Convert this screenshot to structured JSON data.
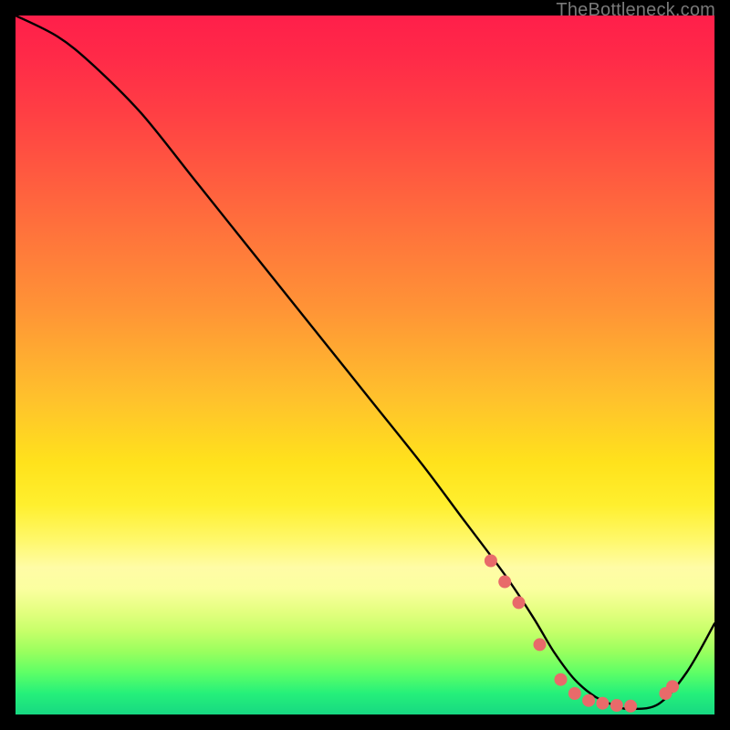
{
  "watermark": "TheBottleneck.com",
  "chart_data": {
    "type": "line",
    "title": "",
    "xlabel": "",
    "ylabel": "",
    "xlim": [
      0,
      100
    ],
    "ylim": [
      0,
      100
    ],
    "grid": false,
    "legend": false,
    "series": [
      {
        "name": "curve",
        "x": [
          0,
          6,
          11,
          18,
          26,
          34,
          42,
          50,
          58,
          64,
          70,
          74,
          77,
          80,
          83,
          86,
          88,
          92,
          96,
          100
        ],
        "y": [
          100,
          97,
          93,
          86,
          76,
          66,
          56,
          46,
          36,
          28,
          20,
          14,
          9,
          5,
          2.5,
          1.2,
          0.8,
          1.5,
          6,
          13
        ],
        "note": "y is approximate bottleneck percentage; curve shows steep decrease, near-zero trough around x≈80–90, then rises"
      }
    ],
    "markers": {
      "note": "salmon dots along the near-bottom portion of the curve",
      "x": [
        68,
        70,
        72,
        75,
        78,
        80,
        82,
        84,
        86,
        88,
        93,
        94
      ],
      "y": [
        22,
        19,
        16,
        10,
        5,
        3,
        2,
        1.6,
        1.3,
        1.2,
        3,
        4
      ]
    },
    "background_gradient": {
      "orientation": "vertical",
      "stops": [
        {
          "pos": 0.0,
          "color": "#ff1f4a"
        },
        {
          "pos": 0.28,
          "color": "#ff6a3d"
        },
        {
          "pos": 0.55,
          "color": "#ffc22c"
        },
        {
          "pos": 0.75,
          "color": "#fff86a"
        },
        {
          "pos": 0.9,
          "color": "#9aff5e"
        },
        {
          "pos": 1.0,
          "color": "#17d882"
        }
      ]
    },
    "colors": {
      "curve": "#000000",
      "markers": "#e86a6a",
      "frame": "#000000"
    }
  }
}
